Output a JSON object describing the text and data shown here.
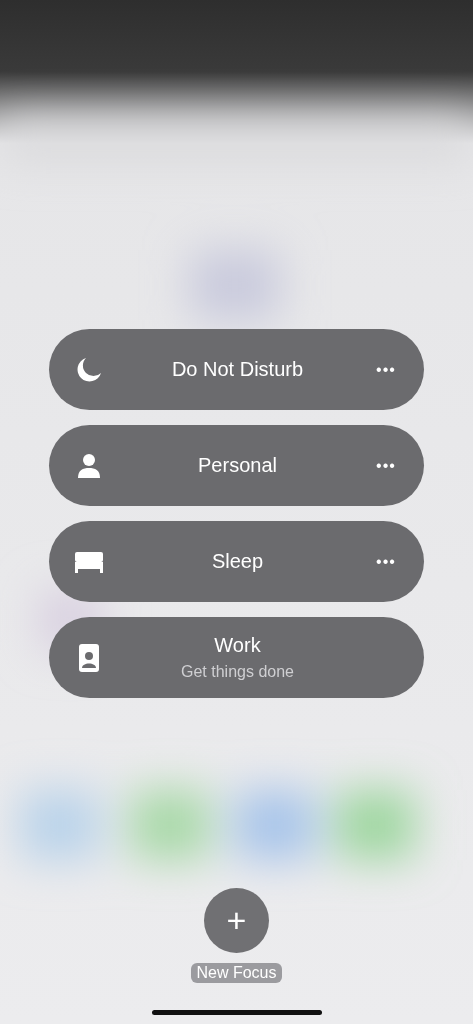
{
  "focus_modes": [
    {
      "name": "Do Not Disturb",
      "kind": "moon",
      "more": "•••"
    },
    {
      "name": "Personal",
      "kind": "person",
      "more": "•••"
    },
    {
      "name": "Sleep",
      "kind": "bed",
      "more": "•••"
    },
    {
      "name": "Work",
      "kind": "badge",
      "subtitle": "Get things done"
    }
  ],
  "new_focus": {
    "symbol": "+",
    "label": "New Focus"
  }
}
